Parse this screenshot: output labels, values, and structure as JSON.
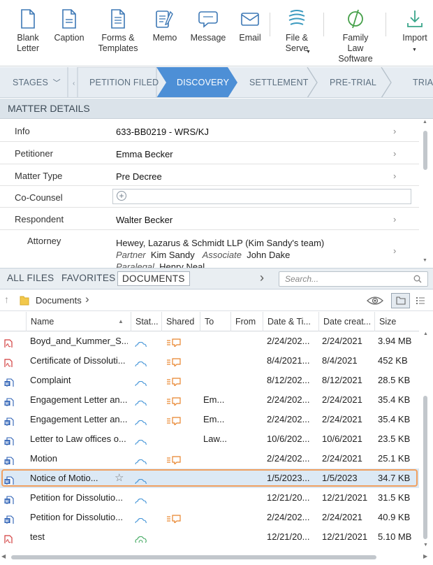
{
  "toolbar": {
    "buttons": [
      {
        "label": "Blank Letter",
        "icon": "blank-letter-icon"
      },
      {
        "label": "Caption",
        "icon": "caption-icon"
      },
      {
        "label": "Forms & Templates",
        "icon": "forms-templates-icon"
      },
      {
        "label": "Memo",
        "icon": "memo-icon"
      },
      {
        "label": "Message",
        "icon": "message-icon"
      },
      {
        "label": "Email",
        "icon": "email-icon"
      },
      {
        "label": "File & Serve",
        "icon": "file-serve-icon",
        "dropdown": true
      },
      {
        "label": "Family Law Software",
        "icon": "family-law-software-icon"
      },
      {
        "label": "Import",
        "icon": "import-icon",
        "dropdown": true
      }
    ],
    "accent": "#4a7fb8"
  },
  "stages": {
    "menu_label": "STAGES",
    "items": [
      "PETITION FILED",
      "DISCOVERY",
      "SETTLEMENT",
      "PRE-TRIAL",
      "TRIAL"
    ],
    "active": "DISCOVERY",
    "active_color": "#4d8fd6"
  },
  "matter": {
    "header": "MATTER DETAILS",
    "rows": [
      {
        "label": "Info",
        "value": "633-BB0219 - WRS/KJ"
      },
      {
        "label": "Petitioner",
        "value": "Emma Becker"
      },
      {
        "label": "Matter Type",
        "value": "Pre Decree"
      },
      {
        "label": "Co-Counsel",
        "value": ""
      },
      {
        "label": "Respondent",
        "value": "Walter Becker"
      }
    ],
    "attorney": {
      "label": "Attorney",
      "firm": "Hewey, Lazarus & Schmidt LLP (Kim Sandy's team)",
      "partner_role": "Partner",
      "partner_name": "Kim Sandy",
      "associate_role": "Associate",
      "associate_name": "John Dake",
      "paralegal_role": "Paralegal",
      "paralegal_name": "Henry Neal"
    }
  },
  "tabs": {
    "items": [
      "ALL FILES",
      "FAVORITES",
      "DOCUMENTS"
    ],
    "active": "DOCUMENTS"
  },
  "search": {
    "placeholder": "Search..."
  },
  "path": {
    "folder": "Documents"
  },
  "columns": [
    "Name",
    "Stat...",
    "Shared",
    "To",
    "From",
    "Date & Ti...",
    "Date creat...",
    "Size"
  ],
  "files": [
    {
      "type": "pdf",
      "name": "Boyd_and_Kummer_S...",
      "shared": true,
      "to": "",
      "from": "",
      "date_time": "2/24/202...",
      "date_created": "2/24/2021",
      "size": "3.94 MB"
    },
    {
      "type": "pdf",
      "name": "Certificate of Dissoluti...",
      "shared": true,
      "to": "",
      "from": "",
      "date_time": "8/4/2021...",
      "date_created": "8/4/2021",
      "size": "452 KB"
    },
    {
      "type": "word",
      "name": "Complaint",
      "shared": true,
      "to": "",
      "from": "",
      "date_time": "8/12/202...",
      "date_created": "8/12/2021",
      "size": "28.5 KB"
    },
    {
      "type": "word",
      "name": "Engagement Letter an...",
      "shared": true,
      "to": "Em...",
      "from": "",
      "date_time": "2/24/202...",
      "date_created": "2/24/2021",
      "size": "35.4 KB"
    },
    {
      "type": "word",
      "name": "Engagement Letter an...",
      "shared": true,
      "to": "Em...",
      "from": "",
      "date_time": "2/24/202...",
      "date_created": "2/24/2021",
      "size": "35.4 KB"
    },
    {
      "type": "word",
      "name": "Letter to Law offices o...",
      "shared": false,
      "to": "Law...",
      "from": "",
      "date_time": "10/6/202...",
      "date_created": "10/6/2021",
      "size": "23.5 KB"
    },
    {
      "type": "word",
      "name": "Motion",
      "shared": true,
      "to": "",
      "from": "",
      "date_time": "2/24/202...",
      "date_created": "2/24/2021",
      "size": "25.1 KB"
    },
    {
      "type": "word",
      "name": "Notice of Motio...",
      "shared": false,
      "to": "",
      "from": "",
      "date_time": "1/5/2023...",
      "date_created": "1/5/2023",
      "size": "34.7 KB",
      "selected": true,
      "star": true
    },
    {
      "type": "word",
      "name": "Petition for Dissolutio...",
      "shared": false,
      "to": "",
      "from": "",
      "date_time": "12/21/20...",
      "date_created": "12/21/2021",
      "size": "31.5 KB"
    },
    {
      "type": "word",
      "name": "Petition for Dissolutio...",
      "shared": true,
      "to": "",
      "from": "",
      "date_time": "2/24/202...",
      "date_created": "2/24/2021",
      "size": "40.9 KB"
    },
    {
      "type": "pdf",
      "name": "test",
      "shared": false,
      "to": "",
      "from": "",
      "date_time": "12/21/20...",
      "date_created": "12/21/2021",
      "size": "5.10 MB",
      "status": "syncing"
    }
  ]
}
